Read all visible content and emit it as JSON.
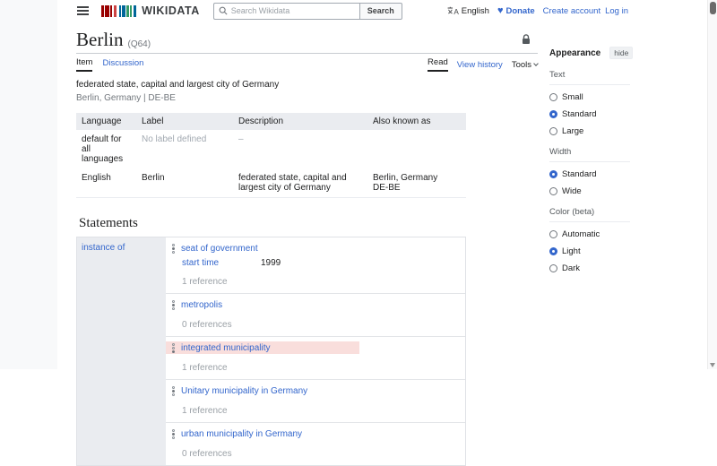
{
  "header": {
    "logo_text": "WIKIDATA",
    "search": {
      "placeholder": "Search Wikidata",
      "button_label": "Search"
    },
    "language_label": "English",
    "donate_label": "Donate",
    "create_account_label": "Create account",
    "log_in_label": "Log in"
  },
  "page": {
    "title": "Berlin",
    "entity_id": "(Q64)",
    "tab_item": "Item",
    "tab_discussion": "Discussion",
    "view_read": "Read",
    "view_history": "View history",
    "view_tools": "Tools",
    "description": "federated state, capital and largest city of Germany",
    "aliases_line": "Berlin, Germany | DE-BE"
  },
  "terms_table": {
    "headers": {
      "language": "Language",
      "label": "Label",
      "description": "Description",
      "also_known_as": "Also known as"
    },
    "rows": [
      {
        "language": "default for all languages",
        "label": "No label defined",
        "description": "–",
        "aliases": [
          "",
          ""
        ]
      },
      {
        "language": "English",
        "label": "Berlin",
        "description": "federated state, capital and largest city of Germany",
        "aliases": [
          "Berlin, Germany",
          "DE-BE"
        ]
      }
    ]
  },
  "statements": {
    "heading": "Statements",
    "property": "instance of",
    "claims": [
      {
        "value": "seat of government",
        "qualifier_property": "start time",
        "qualifier_value": "1999",
        "references": "1 reference",
        "highlighted": false
      },
      {
        "value": "metropolis",
        "references": "0 references",
        "highlighted": false
      },
      {
        "value": "integrated municipality",
        "references": "1 reference",
        "highlighted": true
      },
      {
        "value": "Unitary municipality in Germany",
        "references": "1 reference",
        "highlighted": false
      },
      {
        "value": "urban municipality in Germany",
        "references": "0 references",
        "highlighted": false
      }
    ]
  },
  "appearance": {
    "title": "Appearance",
    "hide_label": "hide",
    "sections": [
      {
        "label": "Text",
        "options": [
          {
            "label": "Small",
            "selected": false
          },
          {
            "label": "Standard",
            "selected": true
          },
          {
            "label": "Large",
            "selected": false
          }
        ]
      },
      {
        "label": "Width",
        "options": [
          {
            "label": "Standard",
            "selected": true
          },
          {
            "label": "Wide",
            "selected": false
          }
        ]
      },
      {
        "label": "Color (beta)",
        "options": [
          {
            "label": "Automatic",
            "selected": false
          },
          {
            "label": "Light",
            "selected": true
          },
          {
            "label": "Dark",
            "selected": false
          }
        ]
      }
    ]
  },
  "colors": {
    "link_blue": "#3366cc",
    "deprecated_highlight": "#f9dedc",
    "table_header_bg": "#eaecf0",
    "logo_red": "#990000",
    "logo_blue": "#006699",
    "logo_green": "#339966"
  }
}
